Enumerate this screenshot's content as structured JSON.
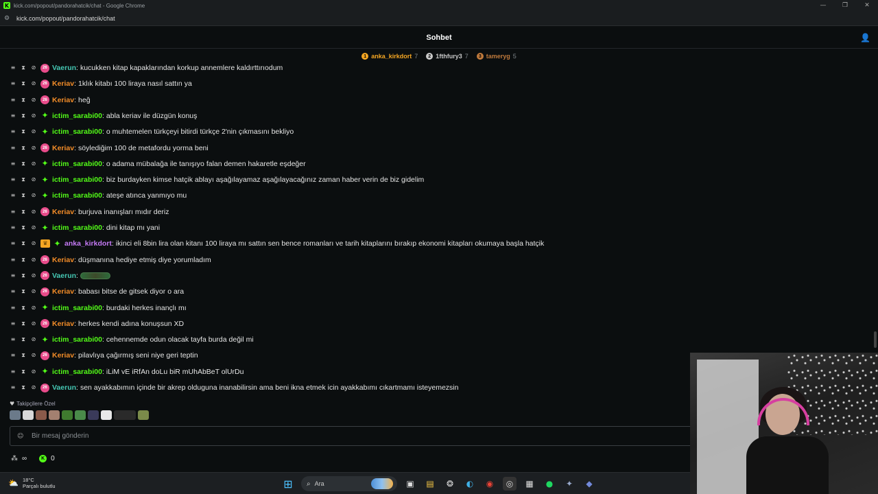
{
  "browser": {
    "window_title": "kick.com/popout/pandorahatcik/chat - Google Chrome",
    "url": "kick.com/popout/pandorahatcik/chat"
  },
  "chat": {
    "title": "Sohbet",
    "leaderboard": [
      {
        "rank": "1",
        "name": "anka_kirkdort",
        "count": "7",
        "color": "#f5a623"
      },
      {
        "rank": "2",
        "name": "1fthfury3",
        "count": "7",
        "color": "#c9c9c9"
      },
      {
        "rank": "3",
        "name": "tameryg",
        "count": "5",
        "color": "#c07a3c"
      }
    ],
    "colors": {
      "vaerun": "#45c8b4",
      "keriav": "#f28c28",
      "ictim": "#53fc18",
      "anka": "#c57af5"
    },
    "messages": [
      {
        "user": "Vaerun",
        "badge": "sub",
        "text": "kucukken kitap kapaklarından korkup annemlere kaldırttırıodum"
      },
      {
        "user": "Keriav",
        "badge": "sub",
        "text": "1klık kitabı 100 liraya nasıl sattın ya"
      },
      {
        "user": "Keriav",
        "badge": "sub",
        "text": "heğ"
      },
      {
        "user": "ictim_sarabi00",
        "badge": "og",
        "text": "abla keriav ile düzgün konuş"
      },
      {
        "user": "ictim_sarabi00",
        "badge": "og",
        "text": "o muhtemelen türkçeyi bitirdi türkçe 2'nin çıkmasını bekliyo"
      },
      {
        "user": "Keriav",
        "badge": "sub",
        "text": "söylediğim 100 de metafordu yorma beni"
      },
      {
        "user": "ictim_sarabi00",
        "badge": "og",
        "text": "o adama mübalağa ile tanışıyo falan demen hakaretle eşdeğer"
      },
      {
        "user": "ictim_sarabi00",
        "badge": "og",
        "text": "biz burdayken kimse hatçik ablayı aşağılayamaz aşağılayacağınız zaman haber verin de biz gidelim"
      },
      {
        "user": "ictim_sarabi00",
        "badge": "og",
        "text": "ateşe atınca yanmıyo mu"
      },
      {
        "user": "Keriav",
        "badge": "sub",
        "text": "burjuva inanışları mıdır deriz"
      },
      {
        "user": "ictim_sarabi00",
        "badge": "og",
        "text": "dini kitap mı yani"
      },
      {
        "user": "anka_kirkdort",
        "badge": "crown",
        "text": "ikinci eli 8bin lira olan kitanı 100 liraya mı sattın sen bence romanları ve tarih kitaplarını bırakıp ekonomi kitapları okumaya başla hatçik"
      },
      {
        "user": "Keriav",
        "badge": "sub",
        "text": "düşmanına hediye etmiş diye yorumladım"
      },
      {
        "user": "Vaerun",
        "badge": "sub",
        "text": "",
        "emote": true
      },
      {
        "user": "Keriav",
        "badge": "sub",
        "text": "babası bitse de gitsek diyor o ara"
      },
      {
        "user": "ictim_sarabi00",
        "badge": "og",
        "text": "burdaki herkes inançlı mı"
      },
      {
        "user": "Keriav",
        "badge": "sub",
        "text": "herkes kendi adına konuşsun XD"
      },
      {
        "user": "ictim_sarabi00",
        "badge": "og",
        "text": "cehennemde odun olacak tayfa burda değil mi"
      },
      {
        "user": "Keriav",
        "badge": "sub",
        "text": "pilavlıya çağırmış seni niye geri teptin"
      },
      {
        "user": "ictim_sarabi00",
        "badge": "og",
        "text": "iLiM vE iRfAn doLu biR mUhAbBeT olUrDu"
      },
      {
        "user": "Vaerun",
        "badge": "sub",
        "text": "sen ayakkabımın içinde bir akrep olduguna inanabilirsin ama beni ikna etmek icin ayakkabımı cıkartmamı isteyemezsin"
      }
    ],
    "sub_badge_label": "26",
    "emote_label": "Takipçilere Özel",
    "input_placeholder": "Bir mesaj gönderin",
    "infinity": "∞",
    "points": "0"
  },
  "taskbar": {
    "temp": "18°C",
    "weather": "Parçalı bulutlu",
    "search_label": "Ara"
  }
}
